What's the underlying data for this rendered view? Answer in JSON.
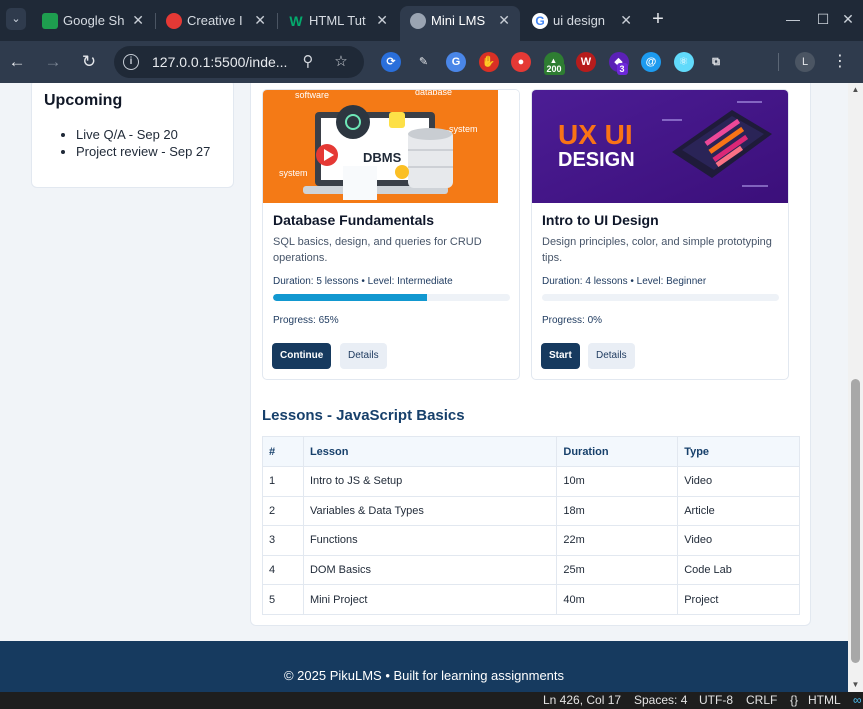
{
  "browser": {
    "tabs": [
      {
        "title": "Google Sh",
        "icon": "sheets-icon"
      },
      {
        "title": "Creative I",
        "icon": "creative-cloud-icon"
      },
      {
        "title": "HTML Tut",
        "icon": "w3schools-icon"
      },
      {
        "title": "Mini LMS",
        "icon": "globe-icon",
        "active": true
      },
      {
        "title": "ui design",
        "icon": "google-icon"
      }
    ],
    "url": "127.0.0.1:5500/inde...",
    "extensions": [
      {
        "name": "ext-blue-circle-icon",
        "color": "#2a6fdb"
      },
      {
        "name": "eyedropper-icon",
        "color": "#e5e7eb"
      },
      {
        "name": "translate-icon",
        "color": "#4a86e8"
      },
      {
        "name": "hand-stop-icon",
        "color": "#d93025"
      },
      {
        "name": "pokeball-icon",
        "color": "#e53935"
      },
      {
        "name": "counter-ext-icon",
        "color": "#2e7d32",
        "badge": "200"
      },
      {
        "name": "w-ext-icon",
        "color": "#b71c1c"
      },
      {
        "name": "purple-ext-icon",
        "color": "#5b21b6",
        "badge": "3"
      },
      {
        "name": "at-sign-icon",
        "color": "#1d9bf0"
      },
      {
        "name": "react-icon",
        "color": "#61dafb"
      },
      {
        "name": "puzzle-icon",
        "color": "#e5e7eb"
      }
    ],
    "profile_initial": "L"
  },
  "sidebar": {
    "title": "Upcoming",
    "items": [
      "Live Q/A - Sep 20",
      "Project review - Sep 27"
    ]
  },
  "courses": [
    {
      "title": "Database Fundamentals",
      "description": "SQL basics, design, and queries for CRUD operations.",
      "meta": "Duration: 5 lessons • Level: Intermediate",
      "progress": 65,
      "progress_label": "Progress: 65%",
      "primary_action": "Continue",
      "secondary_action": "Details",
      "image_texts": [
        "software",
        "database",
        "system",
        "system",
        "DBMS"
      ]
    },
    {
      "title": "Intro to UI Design",
      "description": "Design principles, color, and simple prototyping tips.",
      "meta": "Duration: 4 lessons • Level: Beginner",
      "progress": 0,
      "progress_label": "Progress: 0%",
      "primary_action": "Start",
      "secondary_action": "Details",
      "image_texts": [
        "UX UI",
        "DESIGN"
      ]
    }
  ],
  "lessons": {
    "title": "Lessons - JavaScript Basics",
    "columns": [
      "#",
      "Lesson",
      "Duration",
      "Type"
    ],
    "rows": [
      [
        "1",
        "Intro to JS & Setup",
        "10m",
        "Video"
      ],
      [
        "2",
        "Variables & Data Types",
        "18m",
        "Article"
      ],
      [
        "3",
        "Functions",
        "22m",
        "Video"
      ],
      [
        "4",
        "DOM Basics",
        "25m",
        "Code Lab"
      ],
      [
        "5",
        "Mini Project",
        "40m",
        "Project"
      ]
    ]
  },
  "footer": {
    "text": "© 2025 PikuLMS • Built for learning assignments"
  },
  "statusbar": {
    "position": "Ln 426, Col 17",
    "spaces": "Spaces: 4",
    "encoding": "UTF-8",
    "eol": "CRLF",
    "language": "HTML"
  },
  "colors": {
    "accent": "#163a5f",
    "progress": "#1298d0",
    "heading": "#17406b"
  }
}
